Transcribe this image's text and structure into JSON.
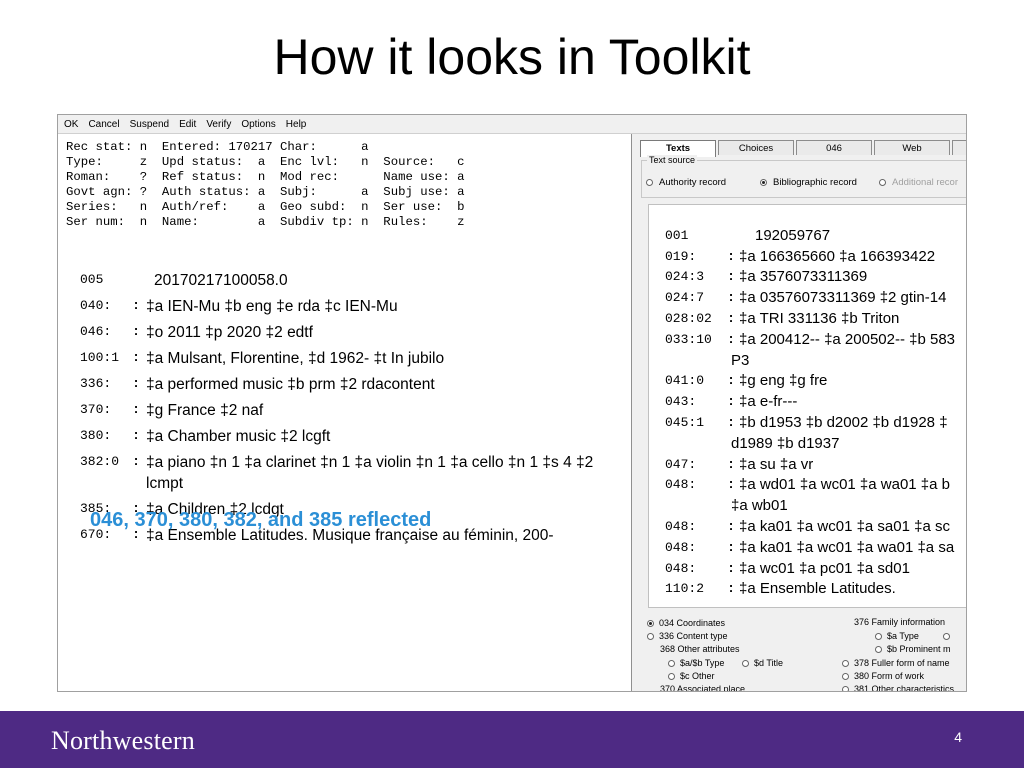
{
  "slide": {
    "title": "How it looks in Toolkit",
    "annotation": "046, 370, 380, 382, and 385 reflected",
    "footer_logo": "Northwestern",
    "page_number": "4"
  },
  "menubar": [
    "OK",
    "Cancel",
    "Suspend",
    "Edit",
    "Verify",
    "Options",
    "Help"
  ],
  "fixed_fields": [
    "Rec stat: n  Entered: 170217 Char:      a",
    "Type:     z  Upd status:  a  Enc lvl:   n  Source:   c",
    "Roman:    ?  Ref status:  n  Mod rec:      Name use: a",
    "Govt agn: ?  Auth status: a  Subj:      a  Subj use: a",
    "Series:   n  Auth/ref:    a  Geo subd:  n  Ser use:  b",
    "Ser num:  n  Name:        a  Subdiv tp: n  Rules:    z"
  ],
  "authority_fields": [
    {
      "tag": "005",
      "colon": "",
      "text": "20170217100058.0"
    },
    {
      "tag": "040:",
      "colon": ":",
      "text": "‡a IEN-Mu ‡b eng ‡e rda ‡c IEN-Mu"
    },
    {
      "tag": "046:",
      "colon": ":",
      "text": "‡o 2011 ‡p 2020 ‡2 edtf"
    },
    {
      "tag": "100:1",
      "colon": ":",
      "text": "‡a Mulsant, Florentine, ‡d 1962- ‡t In jubilo"
    },
    {
      "tag": "336:",
      "colon": ":",
      "text": "‡a performed music ‡b prm ‡2 rdacontent"
    },
    {
      "tag": "370:",
      "colon": ":",
      "text": "‡g France ‡2 naf"
    },
    {
      "tag": "380:",
      "colon": ":",
      "text": "‡a Chamber music ‡2 lcgft"
    },
    {
      "tag": "382:0",
      "colon": ":",
      "text": "‡a piano ‡n 1 ‡a clarinet ‡n 1 ‡a violin ‡n 1 ‡a cello ‡n 1 ‡s 4 ‡2 lcmpt"
    },
    {
      "tag": "385:",
      "colon": ":",
      "text": "‡a Children ‡2 lcdgt"
    },
    {
      "tag": "670:",
      "colon": ":",
      "text": "‡a Ensemble Latitudes. Musique française au féminin, 200-"
    }
  ],
  "right_panel": {
    "tabs": [
      "Texts",
      "Choices",
      "046",
      "Web",
      ""
    ],
    "active_tab": "Texts",
    "text_source_label": "Text source",
    "text_source_options": [
      {
        "label": "Authority record",
        "selected": false,
        "disabled": false
      },
      {
        "label": "Bibliographic record",
        "selected": true,
        "disabled": false
      },
      {
        "label": "Additional recor",
        "selected": false,
        "disabled": true
      }
    ],
    "bib_lines": [
      {
        "tag": "001",
        "colon": "",
        "text": "192059767",
        "cont": false
      },
      {
        "tag": "019:",
        "colon": ":",
        "text": "‡a 166365660 ‡a 166393422",
        "cont": false
      },
      {
        "tag": "024:3",
        "colon": ":",
        "text": "‡a 3576073311369",
        "cont": false
      },
      {
        "tag": "024:7",
        "colon": ":",
        "text": "‡a 03576073311369 ‡2 gtin-14",
        "cont": false
      },
      {
        "tag": "028:02",
        "colon": ":",
        "text": "‡a TRI 331136 ‡b Triton",
        "cont": false
      },
      {
        "tag": "033:10",
        "colon": ":",
        "text": "‡a 200412-- ‡a 200502-- ‡b 583",
        "cont": false
      },
      {
        "tag": "",
        "colon": "",
        "text": "P3",
        "cont": true
      },
      {
        "tag": "041:0",
        "colon": ":",
        "text": "‡g eng ‡g fre",
        "cont": false
      },
      {
        "tag": "043:",
        "colon": ":",
        "text": "‡a e-fr---",
        "cont": false
      },
      {
        "tag": "045:1",
        "colon": ":",
        "text": "‡b d1953 ‡b d2002 ‡b d1928 ‡",
        "cont": false
      },
      {
        "tag": "",
        "colon": "",
        "text": "d1989 ‡b d1937",
        "cont": true
      },
      {
        "tag": "047:",
        "colon": ":",
        "text": "‡a su ‡a vr",
        "cont": false
      },
      {
        "tag": "048:",
        "colon": ":",
        "text": "‡a wd01 ‡a wc01 ‡a wa01 ‡a b",
        "cont": false
      },
      {
        "tag": "",
        "colon": "",
        "text": "‡a wb01",
        "cont": true
      },
      {
        "tag": "048:",
        "colon": ":",
        "text": "‡a ka01 ‡a wc01 ‡a sa01 ‡a sc",
        "cont": false
      },
      {
        "tag": "048:",
        "colon": ":",
        "text": "‡a ka01 ‡a wc01 ‡a wa01 ‡a sa",
        "cont": false
      },
      {
        "tag": "048:",
        "colon": ":",
        "text": "‡a wc01 ‡a pc01 ‡a sd01",
        "cont": false
      },
      {
        "tag": "110:2",
        "colon": ":",
        "text": "‡a Ensemble Latitudes.",
        "cont": false
      }
    ],
    "bottom": {
      "coordinates": "034 Coordinates",
      "content_type": "336 Content type",
      "other_attributes": "368 Other attributes",
      "ab_type": "$a/$b Type",
      "d_title": "$d Title",
      "c_other": "$c Other",
      "associated_place": "370 Associated place",
      "family_information": "376 Family information",
      "a_type": "$a Type",
      "b_prominent": "$b Prominent m",
      "fuller_form": "378 Fuller form of name",
      "form_of_work": "380 Form of work",
      "other_characteristics": "381 Other characteristics"
    }
  }
}
